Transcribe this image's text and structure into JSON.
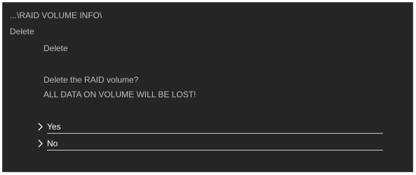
{
  "header": {
    "breadcrumb": "...\\RAID VOLUME INFO\\",
    "title": "Delete"
  },
  "section": {
    "title": "Delete"
  },
  "prompt": {
    "question": "Delete the RAID volume?",
    "warning": "ALL DATA ON VOLUME WILL BE LOST!"
  },
  "options": [
    {
      "label": "Yes",
      "icon": "chevron-right-icon"
    },
    {
      "label": "No",
      "icon": "chevron-right-icon"
    }
  ],
  "colors": {
    "background": "#262525",
    "text_dim": "#bdbdbd",
    "text_bright": "#ffffff",
    "underline": "#c8c8c8"
  }
}
